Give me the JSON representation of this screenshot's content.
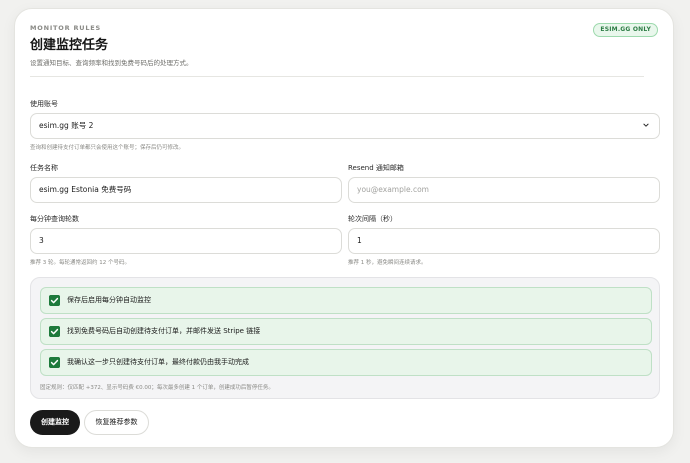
{
  "header": {
    "eyebrow": "MONITOR RULES",
    "title": "创建监控任务",
    "subtitle": "设置通知目标、查询频率和找到免费号码后的处理方式。",
    "badge": "ESIM.GG ONLY"
  },
  "account": {
    "label": "使用账号",
    "value": "esim.gg 账号 2",
    "hint": "查询和创建待支付订单都只会使用这个账号；保存后仍可修改。"
  },
  "task_name": {
    "label": "任务名称",
    "value": "esim.gg Estonia 免费号码"
  },
  "resend_email": {
    "label": "Resend 通知邮箱",
    "placeholder": "you@example.com"
  },
  "rounds_per_minute": {
    "label": "每分钟查询轮数",
    "value": "3",
    "hint": "推荐 3 轮。每轮通常返回约 12 个号码。"
  },
  "interval": {
    "label": "轮次间隔（秒）",
    "value": "1",
    "hint": "推荐 1 秒，避免瞬间连续请求。"
  },
  "options": [
    {
      "label": "保存后启用每分钟自动监控",
      "checked": true
    },
    {
      "label": "找到免费号码后自动创建待支付订单，并邮件发送 Stripe 链接",
      "checked": true
    },
    {
      "label": "我确认这一步只创建待支付订单，最终付款仍由我手动完成",
      "checked": true
    }
  ],
  "rules_note": "固定规则：仅匹配 +372、显示号码费 €0.00；每次最多创建 1 个订单，创建成功后暂停任务。",
  "buttons": {
    "create": "创建监控",
    "reset": "恢复推荐参数"
  },
  "colors": {
    "accent_green": "#1e7a3c",
    "primary_button": "#1a1a1a",
    "badge_border": "#9dd9ad"
  }
}
